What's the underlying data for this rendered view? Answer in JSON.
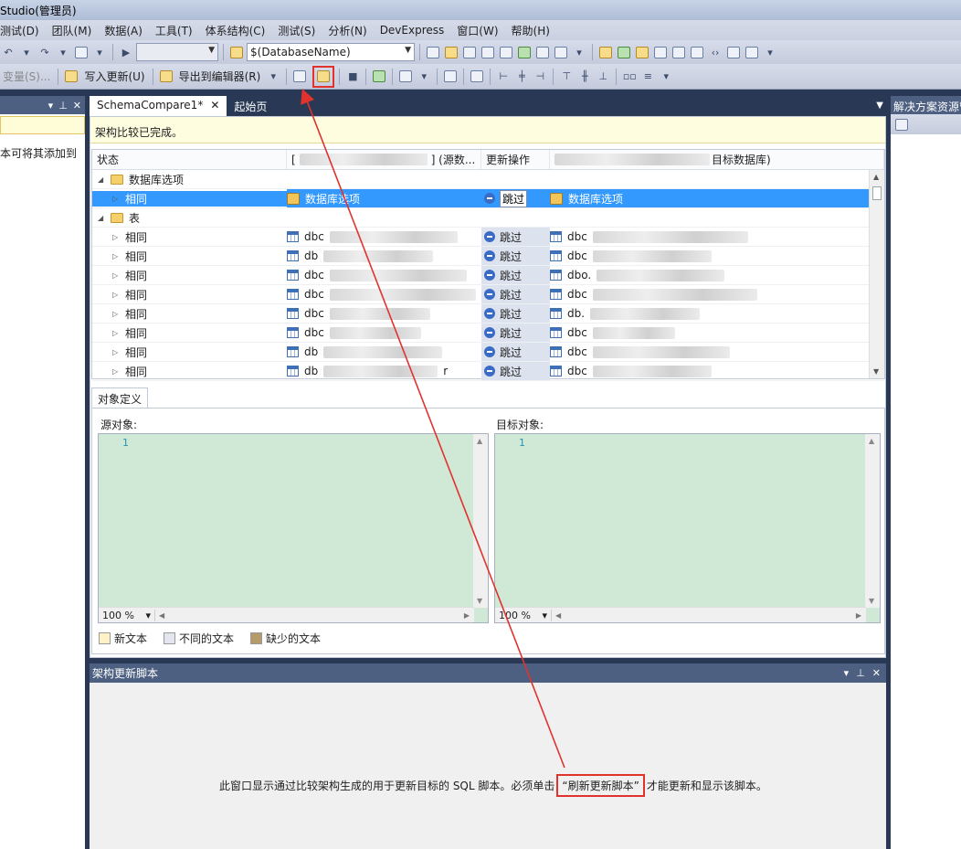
{
  "window": {
    "title": "Studio(管理员)"
  },
  "menu": [
    "测试(D)",
    "团队(M)",
    "数据(A)",
    "工具(T)",
    "体系结构(C)",
    "测试(S)",
    "分析(N)",
    "DevExpress",
    "窗口(W)",
    "帮助(H)"
  ],
  "toolbar1": {
    "db_combo": "$(DatabaseName)"
  },
  "toolbar2": {
    "vars_label": "变量(S)...",
    "write_update": "写入更新(U)",
    "export_editor": "导出到编辑器(R)"
  },
  "left_panel": {
    "text": "本可将其添加到"
  },
  "right_panel": {
    "title": "解决方案资源管理器"
  },
  "tabs": {
    "active": "SchemaCompare1*",
    "inactive": "起始页"
  },
  "infobar": {
    "text": "架构比较已完成。"
  },
  "grid": {
    "col_status": "状态",
    "col_source_suffix": "] (源数...",
    "col_action": "更新操作",
    "col_target_suffix": "目标数据库)",
    "group_db": "数据库选项",
    "group_tables": "表",
    "row_same": "相同",
    "db_options": "数据库选项",
    "skip": "跳过",
    "obj_prefix_dbc": "dbc",
    "obj_prefix_db": "db",
    "obj_prefix_dbdot": "dbo.",
    "obj_prefix_dbs": "db.",
    "obj_suffix_r": "r"
  },
  "object_def": {
    "tab": "对象定义",
    "source_label": "源对象:",
    "target_label": "目标对象:",
    "line_number": "1",
    "zoom": "100 %"
  },
  "legend": {
    "new_text": "新文本",
    "diff_text": "不同的文本",
    "missing_text": "缺少的文本"
  },
  "script_panel": {
    "title": "架构更新脚本",
    "msg_before": "此窗口显示通过比较架构生成的用于更新目标的 SQL 脚本。必须单击",
    "msg_highlight": "“刷新更新脚本”",
    "msg_after": "才能更新和显示该脚本。"
  },
  "colors": {
    "selection": "#3399ff",
    "editor_bg": "#d0e9d6",
    "panel_header": "#4d6082",
    "annotation": "#e0332d",
    "new_text": "#fff2c6",
    "diff_text": "#e3e6ee",
    "missing_text": "#b59b6a"
  }
}
